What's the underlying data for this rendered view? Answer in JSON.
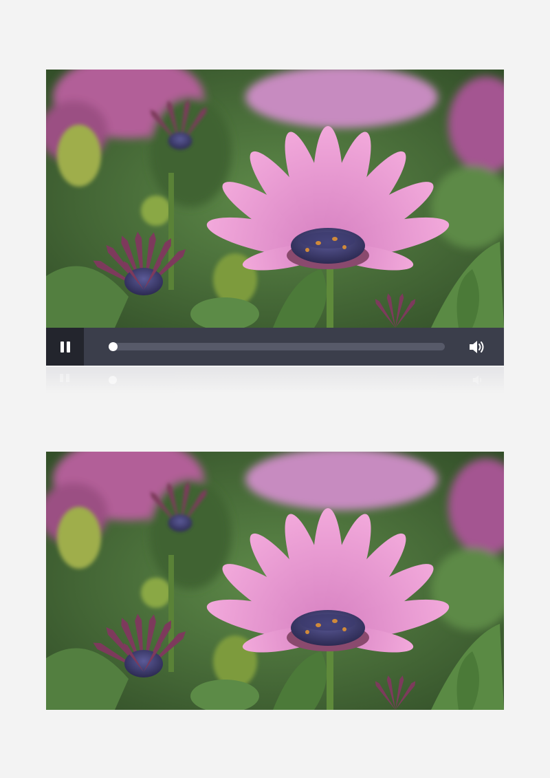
{
  "player": {
    "state": "playing",
    "progress": 0.0,
    "volume_icon": "speaker-icon",
    "pause_icon": "pause-icon"
  },
  "colors": {
    "page_background": "#f3f3f3",
    "control_bar": "#3b3e4b",
    "play_button_bg": "#23252d",
    "progress_track": "#575a69",
    "petal_pink": "#e59ad0",
    "foliage_green": "#4e7a3d"
  }
}
